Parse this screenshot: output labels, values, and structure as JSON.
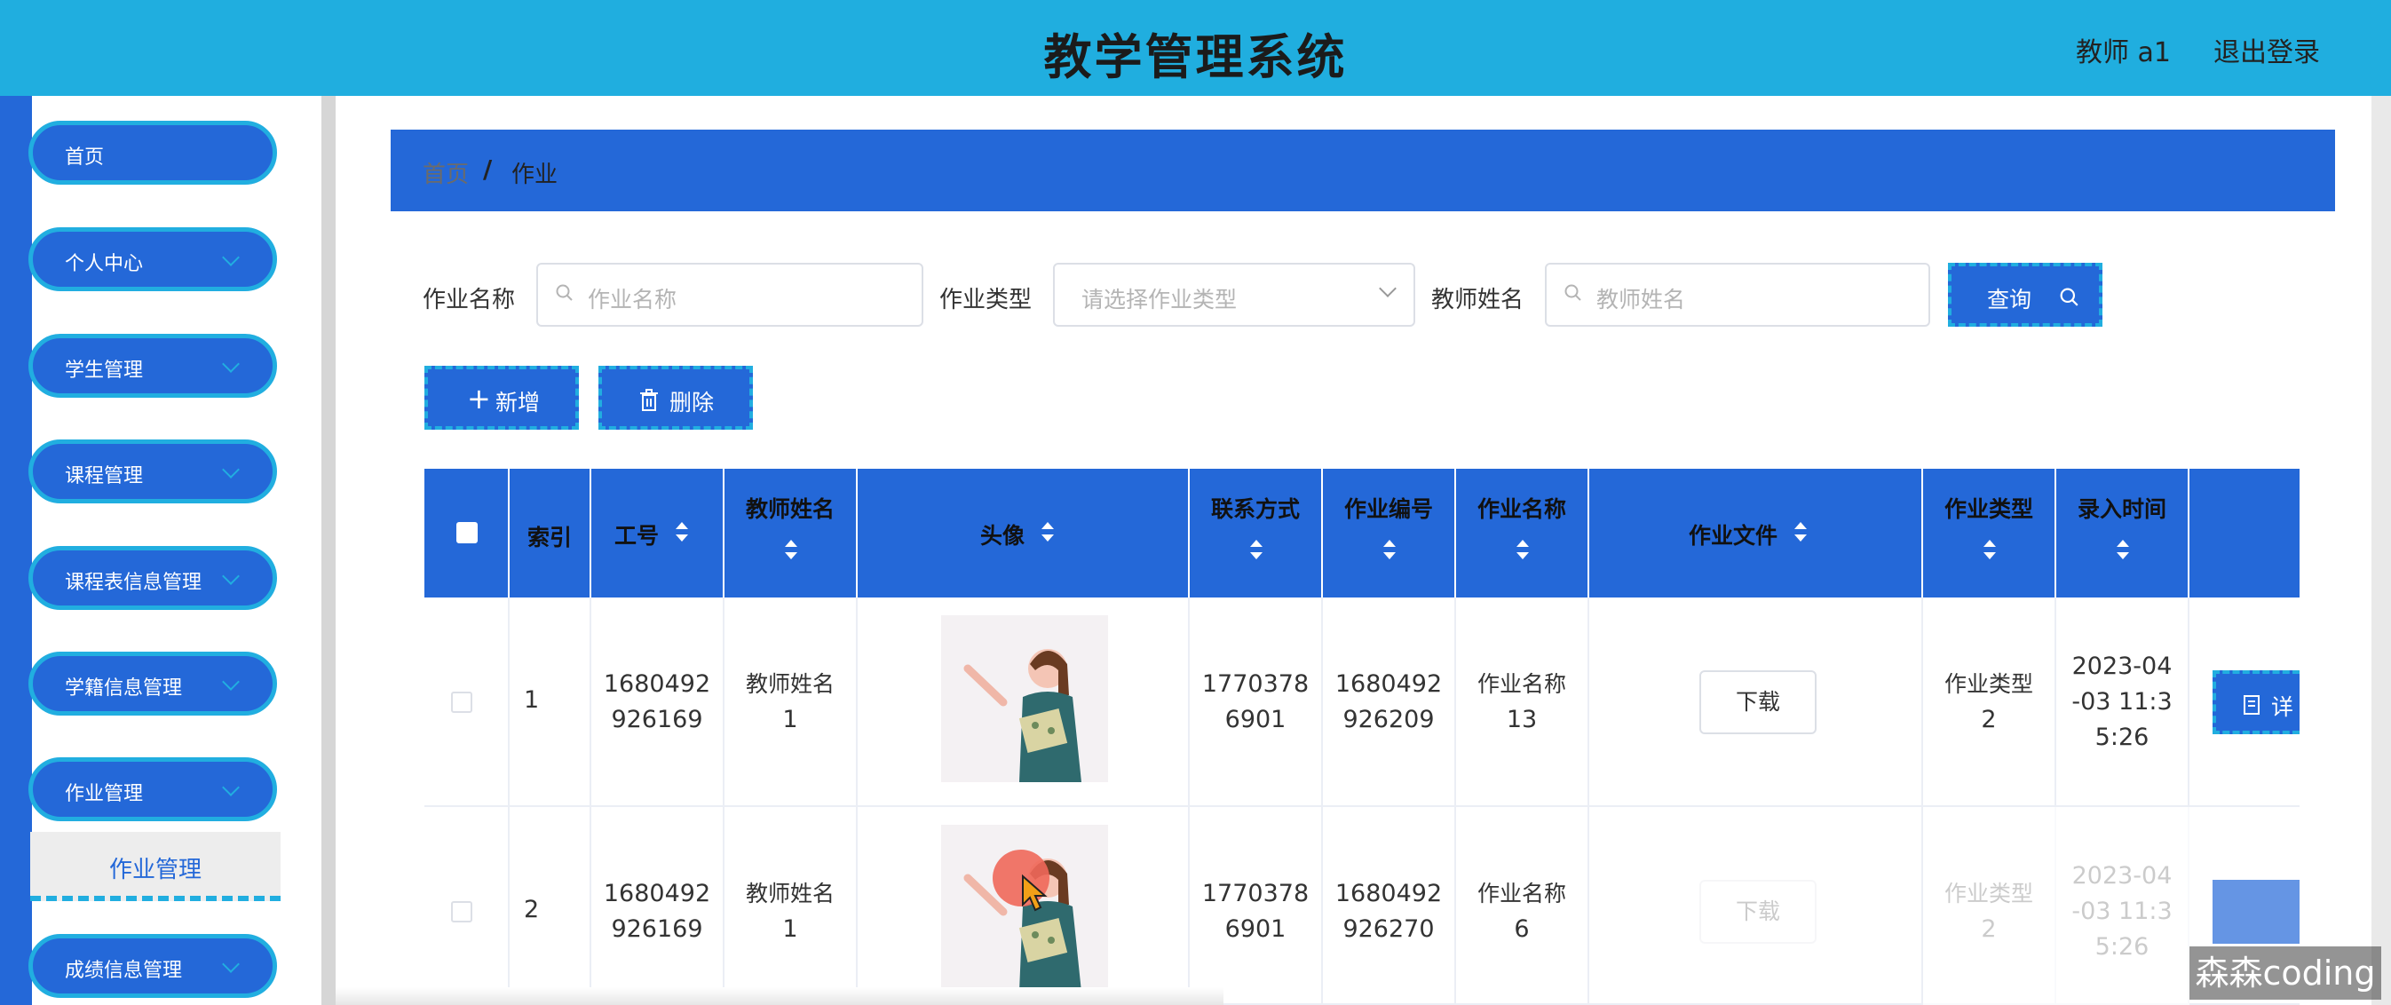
{
  "header": {
    "title": "教学管理系统",
    "user": "教师 a1",
    "logout": "退出登录"
  },
  "sidebar": {
    "items": [
      {
        "label": "首页"
      },
      {
        "label": "个人中心"
      },
      {
        "label": "学生管理"
      },
      {
        "label": "课程管理"
      },
      {
        "label": "课程表信息管理"
      },
      {
        "label": "学籍信息管理"
      },
      {
        "label": "作业管理"
      },
      {
        "label": "成绩信息管理"
      }
    ],
    "active_sub": "作业管理"
  },
  "breadcrumb": {
    "home": "首页",
    "separator": "/",
    "current": "作业"
  },
  "search": {
    "name_label": "作业名称",
    "name_placeholder": "作业名称",
    "type_label": "作业类型",
    "type_placeholder": "请选择作业类型",
    "teacher_label": "教师姓名",
    "teacher_placeholder": "教师姓名",
    "query_button": "查询"
  },
  "actions": {
    "add": "新增",
    "delete": "删除"
  },
  "table": {
    "headers": {
      "index": "索引",
      "work_no": "工号",
      "teacher_name": "教师姓名",
      "avatar": "头像",
      "contact": "联系方式",
      "hw_no": "作业编号",
      "hw_name": "作业名称",
      "hw_file": "作业文件",
      "hw_type": "作业类型",
      "entry_time": "录入时间"
    },
    "rows": [
      {
        "index": "1",
        "work_no_l1": "1680492",
        "work_no_l2": "926169",
        "teacher_l1": "教师姓名",
        "teacher_l2": "1",
        "contact_l1": "1770378",
        "contact_l2": "6901",
        "hw_no_l1": "1680492",
        "hw_no_l2": "926209",
        "hw_name_l1": "作业名称",
        "hw_name_l2": "13",
        "download": "下载",
        "hw_type_l1": "作业类型",
        "hw_type_l2": "2",
        "time_l1": "2023-04",
        "time_l2": "-03 11:3",
        "time_l3": "5:26",
        "detail": "详"
      },
      {
        "index": "2",
        "work_no_l1": "1680492",
        "work_no_l2": "926169",
        "teacher_l1": "教师姓名",
        "teacher_l2": "1",
        "contact_l1": "1770378",
        "contact_l2": "6901",
        "hw_no_l1": "1680492",
        "hw_no_l2": "926270",
        "hw_name_l1": "作业名称",
        "hw_name_l2": "6",
        "download": "下载",
        "hw_type_l1": "作业类型",
        "hw_type_l2": "2",
        "time_l1": "2023-04",
        "time_l2": "-03 11:3",
        "time_l3": "5:26"
      }
    ]
  },
  "watermark": "森森coding",
  "colors": {
    "header": "#20aedf",
    "primary": "#2468d8",
    "accent": "#21aee0"
  }
}
